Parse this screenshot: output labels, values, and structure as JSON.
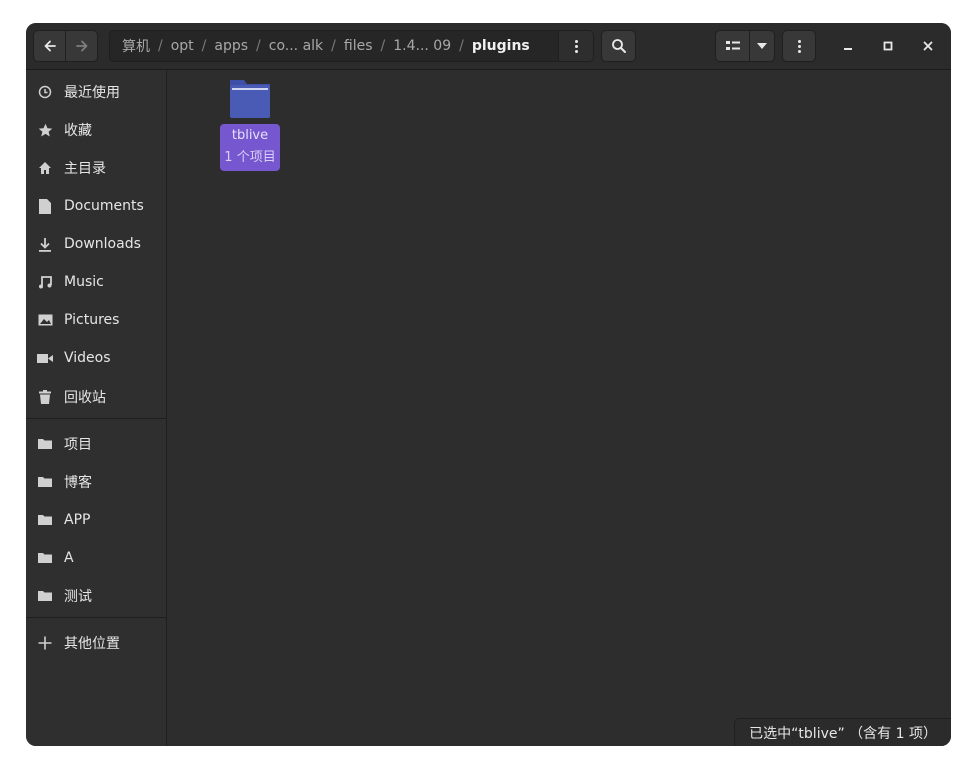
{
  "header": {
    "back_icon": "arrow-left-icon",
    "forward_icon": "arrow-right-icon",
    "breadcrumbs": [
      "算机",
      "opt",
      "apps",
      "co... alk",
      "files",
      "1.4... 09",
      "plugins"
    ],
    "separator": "/",
    "path_menu_icon": "vertical-dots-icon",
    "search_icon": "search-icon",
    "view_list_icon": "list-view-icon",
    "view_dropdown_icon": "chevron-down-icon",
    "main_menu_icon": "vertical-dots-icon",
    "minimize": "–",
    "maximize": "□",
    "close": "×"
  },
  "sidebar": {
    "places": [
      {
        "label": "最近使用",
        "icon": "clock-icon"
      },
      {
        "label": "收藏",
        "icon": "star-icon"
      },
      {
        "label": "主目录",
        "icon": "home-icon"
      },
      {
        "label": "Documents",
        "icon": "document-icon"
      },
      {
        "label": "Downloads",
        "icon": "download-icon"
      },
      {
        "label": "Music",
        "icon": "music-icon"
      },
      {
        "label": "Pictures",
        "icon": "picture-icon"
      },
      {
        "label": "Videos",
        "icon": "video-icon"
      },
      {
        "label": "回收站",
        "icon": "trash-icon"
      }
    ],
    "bookmarks": [
      {
        "label": "项目",
        "icon": "folder-icon"
      },
      {
        "label": "博客",
        "icon": "folder-icon"
      },
      {
        "label": "APP",
        "icon": "folder-icon"
      },
      {
        "label": "A",
        "icon": "folder-icon"
      },
      {
        "label": "测试",
        "icon": "folder-icon"
      }
    ],
    "other": {
      "label": "其他位置",
      "icon": "plus-icon"
    }
  },
  "content": {
    "items": [
      {
        "name": "tblive",
        "subtitle": "1 个项目",
        "icon": "folder-icon",
        "selected": true
      }
    ]
  },
  "status": {
    "text": "已选中“tblive” （含有 1 项）"
  },
  "colors": {
    "accent": "#7657d0",
    "folder": "#4a5bb5",
    "background": "#2d2d2d"
  }
}
